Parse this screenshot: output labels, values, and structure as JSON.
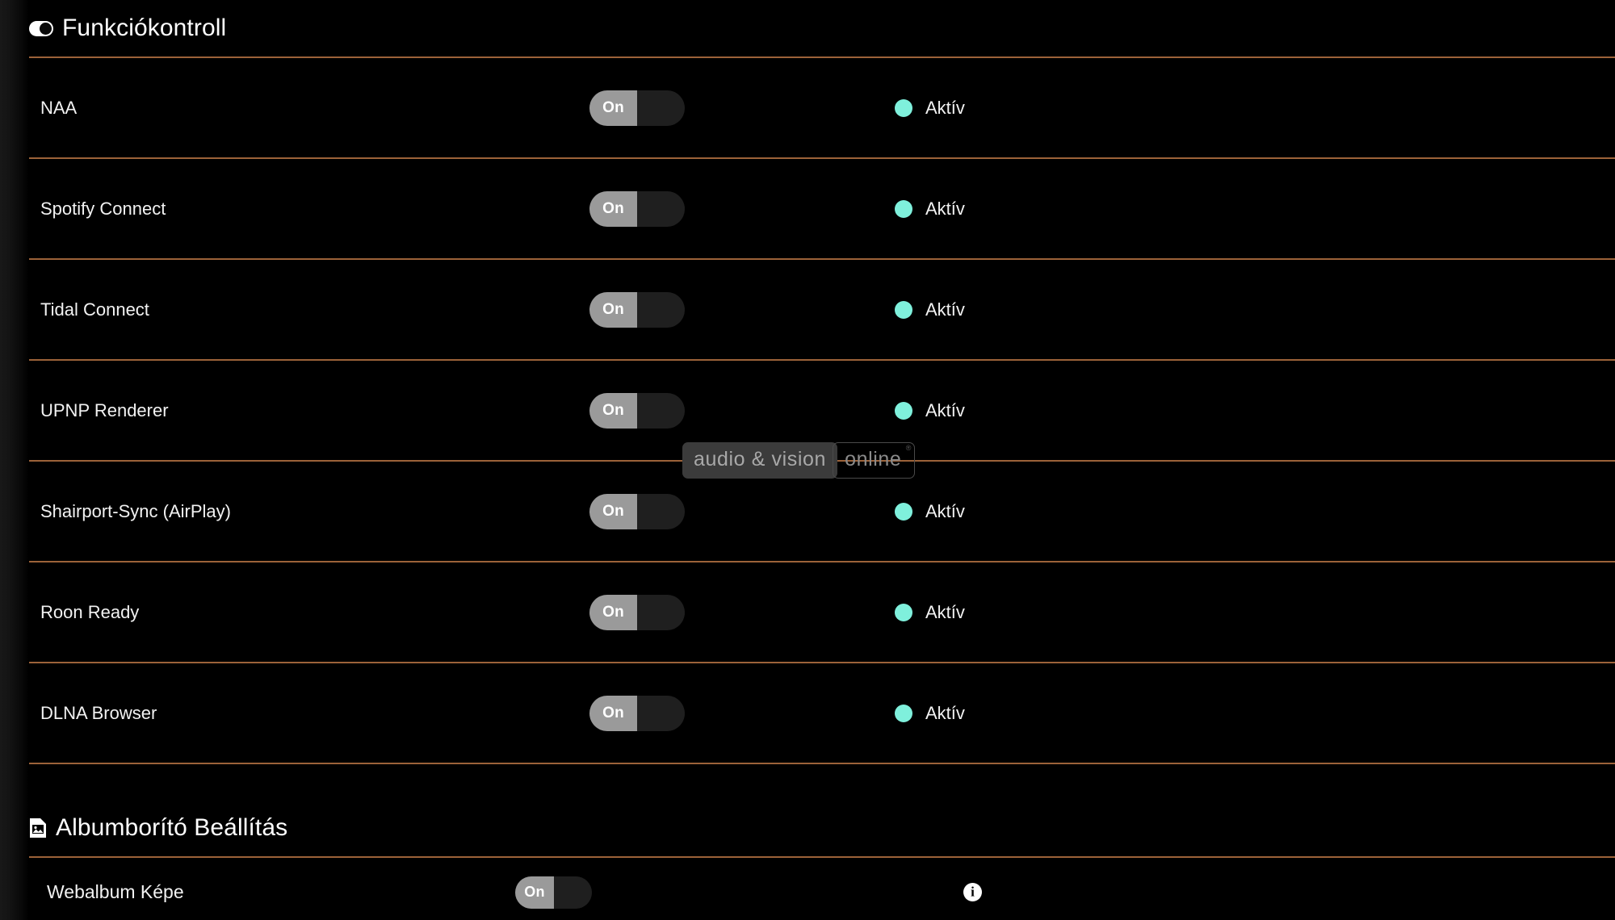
{
  "theme": {
    "background": "#000000",
    "divider_color": "#9c6239",
    "status_dot_color": "#7ff0dc",
    "toggle_on_color": "#9a9a9a",
    "text_color": "#f2f2f2"
  },
  "feature_section": {
    "icon": "toggle-pill-icon",
    "title": "Funkciókontroll",
    "rows": [
      {
        "label": "NAA",
        "toggle_label": "On",
        "status": "Aktív"
      },
      {
        "label": "Spotify Connect",
        "toggle_label": "On",
        "status": "Aktív"
      },
      {
        "label": "Tidal Connect",
        "toggle_label": "On",
        "status": "Aktív"
      },
      {
        "label": "UPNP Renderer",
        "toggle_label": "On",
        "status": "Aktív"
      },
      {
        "label": "Shairport-Sync (AirPlay)",
        "toggle_label": "On",
        "status": "Aktív"
      },
      {
        "label": "Roon Ready",
        "toggle_label": "On",
        "status": "Aktív"
      },
      {
        "label": "DLNA Browser",
        "toggle_label": "On",
        "status": "Aktív"
      }
    ]
  },
  "album_section": {
    "icon": "image-file-icon",
    "title": "Albumborító Beállítás",
    "row": {
      "label": "Webalbum Képe",
      "toggle_label": "On",
      "info_glyph": "i"
    }
  },
  "watermark": {
    "left_text": "audio & vision",
    "right_text": "online",
    "registered_mark": "®"
  }
}
